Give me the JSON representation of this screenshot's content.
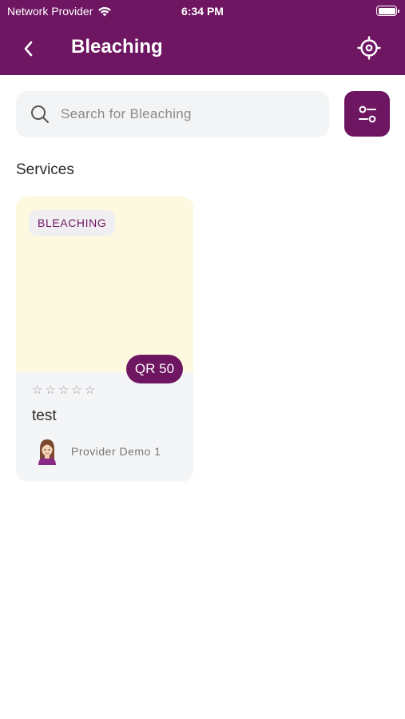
{
  "status_bar": {
    "carrier": "Network Provider",
    "time": "6:34 PM"
  },
  "header": {
    "title": "Bleaching",
    "back_icon": "chevron-left-icon",
    "action_icon": "locate-crosshair-icon"
  },
  "search": {
    "placeholder": "Search for Bleaching",
    "value": ""
  },
  "filter": {
    "icon": "sliders-icon"
  },
  "services_section": {
    "title": "Services"
  },
  "services": [
    {
      "category": "BLEACHING",
      "price": "QR 50",
      "rating": 0,
      "rating_max": 5,
      "name": "test",
      "provider": "Provider Demo 1"
    }
  ],
  "colors": {
    "brand": "#6e1662",
    "card_background": "#f4f5f7",
    "card_image": "#fdf9e0"
  }
}
